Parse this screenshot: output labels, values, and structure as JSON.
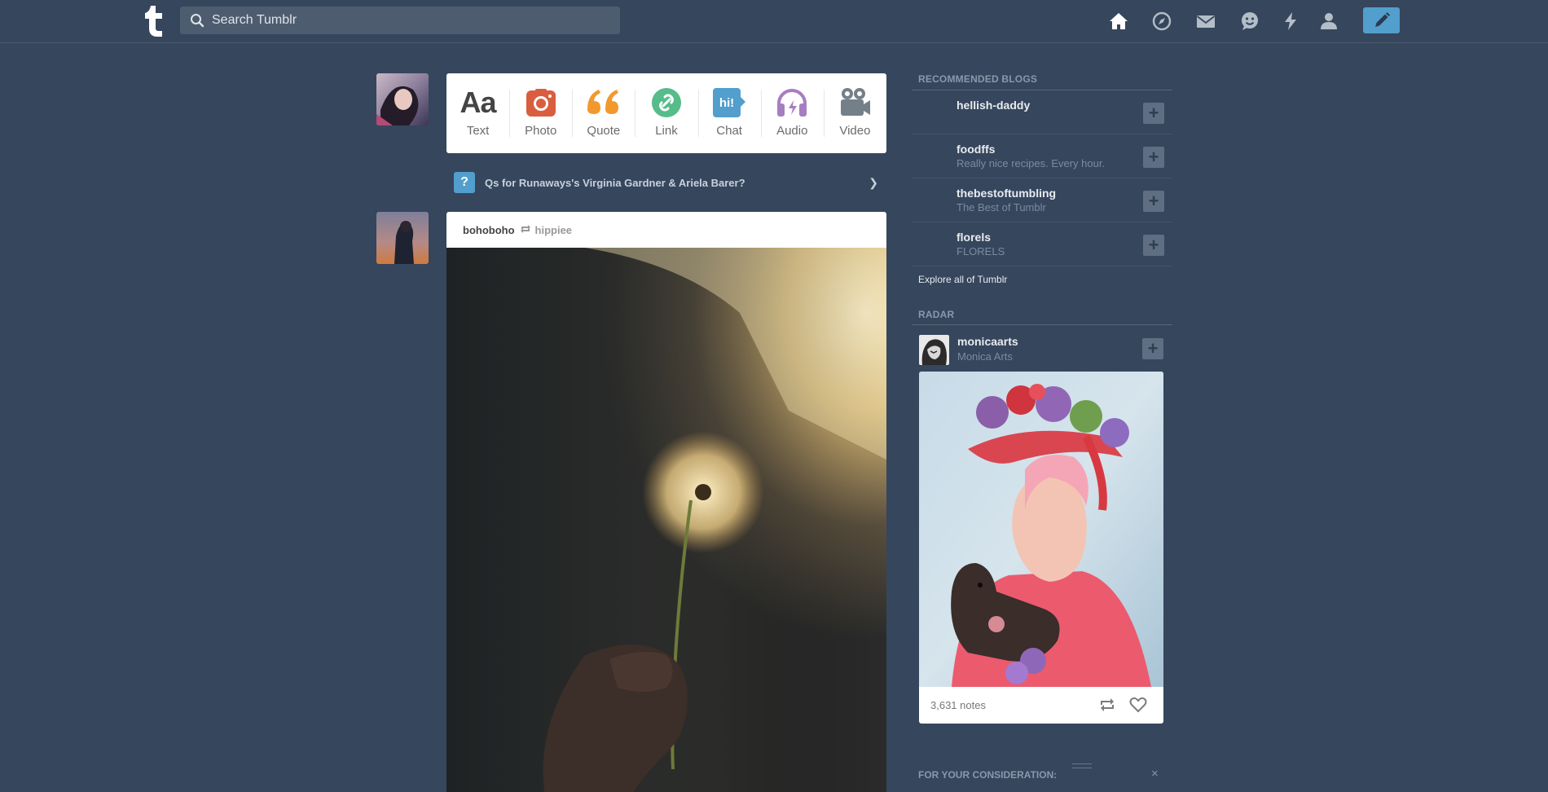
{
  "header": {
    "search_placeholder": "Search Tumblr",
    "nav": [
      "home-icon",
      "explore-icon",
      "inbox-icon",
      "messaging-icon",
      "activity-icon",
      "account-icon"
    ],
    "compose_icon": "pencil-icon",
    "accent": "#529ecc"
  },
  "post_types": [
    {
      "label": "Text",
      "icon": "text-icon",
      "color": "#444444"
    },
    {
      "label": "Photo",
      "icon": "camera-icon",
      "color": "#d95e40"
    },
    {
      "label": "Quote",
      "icon": "quote-icon",
      "color": "#f2992e"
    },
    {
      "label": "Link",
      "icon": "link-icon",
      "color": "#56bc8a"
    },
    {
      "label": "Chat",
      "icon": "chat-icon",
      "color": "#529ecc"
    },
    {
      "label": "Audio",
      "icon": "headphones-icon",
      "color": "#a77dc2"
    },
    {
      "label": "Video",
      "icon": "video-camera-icon",
      "color": "#748089"
    }
  ],
  "question_banner": {
    "icon_text": "?",
    "text": "Qs for Runaways's Virginia Gardner & Ariela Barer?"
  },
  "post": {
    "author": "bohoboho",
    "reblogged_from": "hippiee"
  },
  "sidebar": {
    "recommended_title": "RECOMMENDED BLOGS",
    "recommended": [
      {
        "name": "hellish-daddy",
        "desc": ""
      },
      {
        "name": "foodffs",
        "desc": "Really nice recipes. Every hour."
      },
      {
        "name": "thebestoftumbling",
        "desc": "The Best of Tumblr"
      },
      {
        "name": "florels",
        "desc": "FLORELS"
      }
    ],
    "explore_label": "Explore all of Tumblr",
    "radar_title": "RADAR",
    "radar": {
      "name": "monicaarts",
      "subtitle": "Monica Arts",
      "notes": "3,631 notes"
    },
    "consideration_title": "FOR YOUR CONSIDERATION:",
    "consideration_close": "×"
  }
}
